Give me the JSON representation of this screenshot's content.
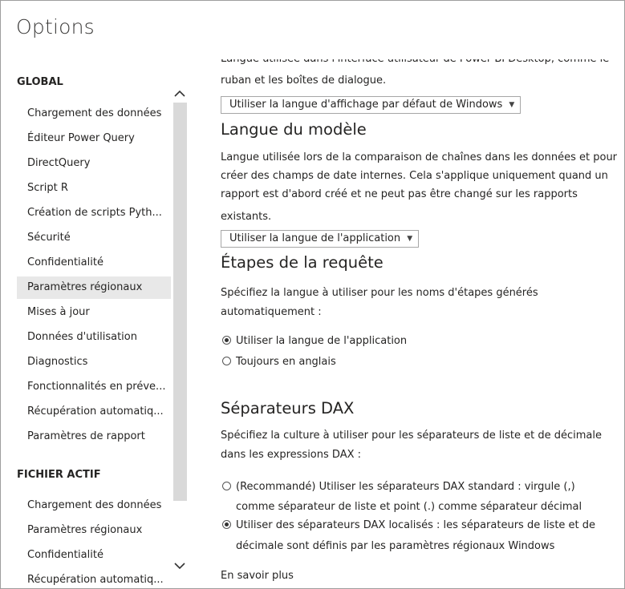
{
  "dialog": {
    "title": "Options"
  },
  "sidebar": {
    "global_heading": "GLOBAL",
    "global_items": [
      {
        "label": "Chargement des données"
      },
      {
        "label": "Éditeur Power Query"
      },
      {
        "label": "DirectQuery"
      },
      {
        "label": "Script R"
      },
      {
        "label": "Création de scripts Pyth..."
      },
      {
        "label": "Sécurité"
      },
      {
        "label": "Confidentialité"
      },
      {
        "label": "Paramètres régionaux",
        "selected": true
      },
      {
        "label": "Mises à jour"
      },
      {
        "label": "Données d'utilisation"
      },
      {
        "label": "Diagnostics"
      },
      {
        "label": "Fonctionnalités en préve..."
      },
      {
        "label": "Récupération automatiq..."
      },
      {
        "label": "Paramètres de rapport"
      }
    ],
    "file_heading": "FICHIER ACTIF",
    "file_items": [
      {
        "label": "Chargement des données"
      },
      {
        "label": "Paramètres régionaux"
      },
      {
        "label": "Confidentialité"
      },
      {
        "label": "Récupération automatiq..."
      }
    ]
  },
  "content": {
    "ui_language": {
      "desc_partial": "Langue utilisée dans l'interface utilisateur de Power BI Desktop, comme le",
      "desc_line2": "ruban et les boîtes de dialogue.",
      "dropdown_value": "Utiliser la langue d'affichage par défaut de Windows"
    },
    "model_language": {
      "heading": "Langue du modèle",
      "desc_lines": [
        "Langue utilisée lors de la comparaison de chaînes dans les données et pour",
        "créer des champs de date internes. Cela s'applique uniquement quand un",
        "rapport est d'abord créé et ne peut pas être changé sur les rapports",
        "existants."
      ],
      "dropdown_value": "Utiliser la langue de l'application"
    },
    "query_steps": {
      "heading": "Étapes de la requête",
      "desc_lines": [
        "Spécifiez la langue à utiliser pour les noms d'étapes générés",
        "automatiquement :"
      ],
      "options": [
        {
          "label": "Utiliser la langue de l'application",
          "checked": true
        },
        {
          "label": "Toujours en anglais",
          "checked": false
        }
      ]
    },
    "dax_separators": {
      "heading": "Séparateurs DAX",
      "desc_lines": [
        "Spécifiez la culture à utiliser pour les séparateurs de liste et de décimale",
        "dans les expressions DAX :"
      ],
      "option1_line1": "(Recommandé) Utiliser les séparateurs DAX standard : virgule (,)",
      "option1_line2": "comme séparateur de liste et point (.) comme séparateur décimal",
      "option2_line1": "Utiliser des séparateurs DAX localisés : les séparateurs de liste et de",
      "option2_line2": "décimale sont définis par les paramètres régionaux Windows",
      "learn_more": "En savoir plus"
    }
  }
}
